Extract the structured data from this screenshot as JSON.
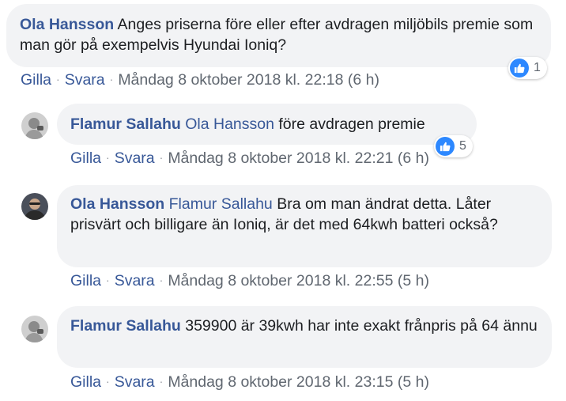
{
  "comments": [
    {
      "author": "Ola Hansson",
      "mention": "",
      "text": "Anges priserna före eller efter avdragen miljöbils premie som man gör på exempelvis Hyundai Ioniq?",
      "like_label": "Gilla",
      "reply_label": "Svara",
      "timestamp": "Måndag 8 oktober 2018 kl. 22:18 (6 h)",
      "reactions": "1"
    },
    {
      "author": "Flamur Sallahu",
      "mention": "Ola Hansson",
      "text": "före avdragen premie",
      "like_label": "Gilla",
      "reply_label": "Svara",
      "timestamp": "Måndag 8 oktober 2018 kl. 22:21 (6 h)",
      "reactions": "5"
    },
    {
      "author": "Ola Hansson",
      "mention": "Flamur Sallahu",
      "text": "Bra om man ändrat detta. Låter prisvärt och billigare än Ioniq, är det med 64kwh batteri också?",
      "like_label": "Gilla",
      "reply_label": "Svara",
      "timestamp": "Måndag 8 oktober 2018 kl. 22:55 (5 h)"
    },
    {
      "author": "Flamur Sallahu",
      "mention": "",
      "text": "359900 är 39kwh har inte exakt frånpris på 64 ännu",
      "like_label": "Gilla",
      "reply_label": "Svara",
      "timestamp": "Måndag 8 oktober 2018 kl. 23:15 (5 h)"
    }
  ],
  "colors": {
    "link": "#385898",
    "bubble": "#f2f3f5",
    "like": "#2d88ff",
    "meta": "#606770"
  },
  "icons": {
    "reaction": "like-thumb-icon"
  }
}
